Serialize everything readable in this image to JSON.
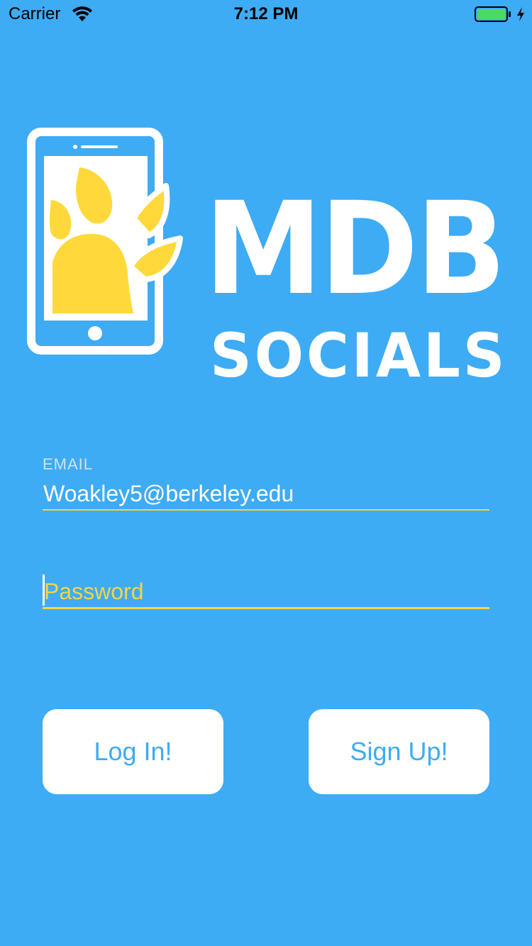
{
  "status_bar": {
    "carrier": "Carrier",
    "time": "7:12 PM",
    "battery_color": "#4cd964"
  },
  "logo": {
    "title": "MDB",
    "subtitle": "SOCIALS",
    "paw_color": "#ffd93b",
    "phone_icon": "phone-icon",
    "paw_icon": "paw-icon"
  },
  "form": {
    "email": {
      "label": "EMAIL",
      "value": "Woakley5@berkeley.edu"
    },
    "password": {
      "placeholder": "Password"
    }
  },
  "buttons": {
    "login_label": "Log In!",
    "signup_label": "Sign Up!"
  },
  "colors": {
    "background": "#3eabf5",
    "accent": "#f4d640",
    "button_text": "#3eabf5"
  }
}
